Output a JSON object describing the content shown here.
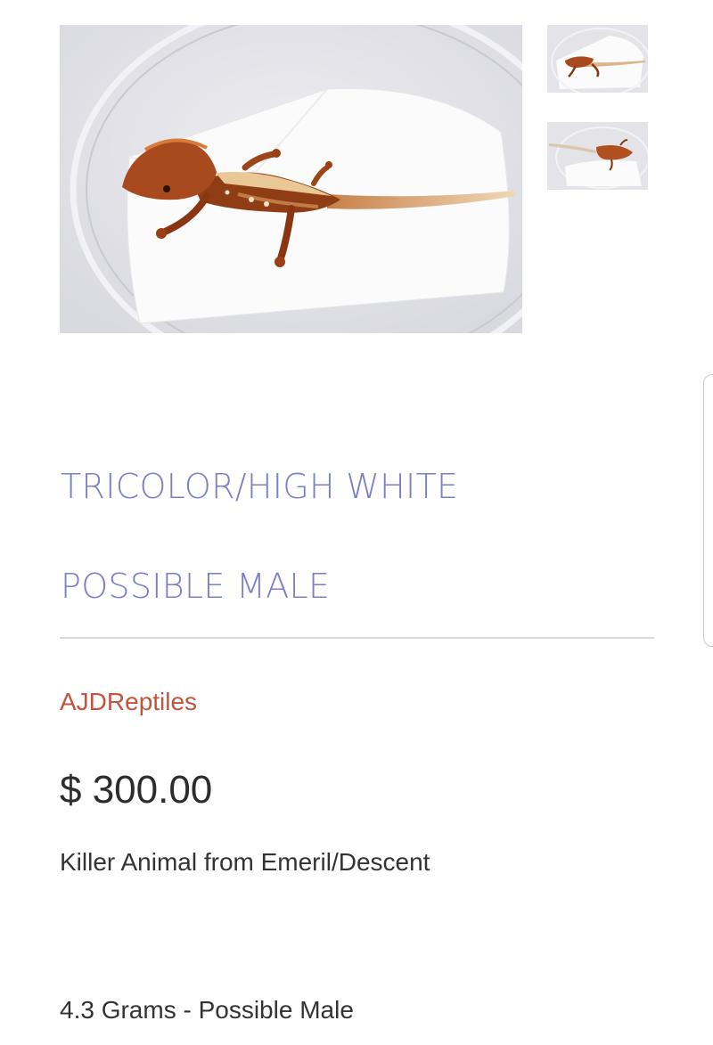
{
  "product": {
    "title_line_1": "TRICOLOR/HIGH WHITE",
    "title_line_2": "POSSIBLE MALE",
    "vendor": "AJDReptiles",
    "price": "$ 300.00",
    "description": "Killer Animal from Emeril/Descent",
    "weight_note": "4.3 Grams - Possible Male"
  },
  "gallery": {
    "main_image": "crested-gecko-photo",
    "thumbnails": [
      "crested-gecko-thumbnail-1",
      "crested-gecko-thumbnail-2"
    ]
  },
  "colors": {
    "title": "#7b7fc6",
    "vendor": "#c5533d",
    "price": "#2c2c2c",
    "body_text": "#333333",
    "divider": "#d9d9d9"
  }
}
